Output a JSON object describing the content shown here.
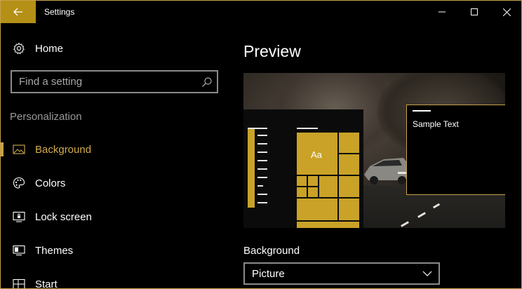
{
  "window": {
    "title": "Settings",
    "accent": "#c7a14a",
    "back_icon": "back-arrow-icon"
  },
  "sidebar": {
    "home_label": "Home",
    "search_placeholder": "Find a setting",
    "section_label": "Personalization",
    "items": [
      {
        "label": "Background",
        "icon": "picture-icon",
        "active": true
      },
      {
        "label": "Colors",
        "icon": "palette-icon",
        "active": false
      },
      {
        "label": "Lock screen",
        "icon": "lock-screen-icon",
        "active": false
      },
      {
        "label": "Themes",
        "icon": "themes-icon",
        "active": false
      },
      {
        "label": "Start",
        "icon": "start-icon",
        "active": false
      }
    ]
  },
  "main": {
    "preview_title": "Preview",
    "sample_text": "Sample Text",
    "tile_text": "Aa",
    "background_label": "Background",
    "background_value": "Picture"
  }
}
